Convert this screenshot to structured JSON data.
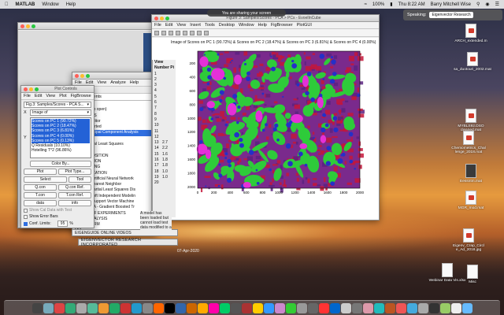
{
  "menubar": {
    "apple": "",
    "app": "MATLAB",
    "items": [
      "Window",
      "Help"
    ],
    "battery": "100%",
    "clock": "Thu 8:22 AM",
    "user": "Barry Mitchell Wise"
  },
  "speaking": {
    "label": "Speaking:",
    "value": "Eigenvector Research"
  },
  "sharing": {
    "text": "You are sharing your screen"
  },
  "figure": {
    "title": "Figure 3: Samples/Scores - PCA > PCs - EvoelInCube",
    "menu": [
      "File",
      "Edit",
      "View",
      "Insert",
      "Tools",
      "Desktop",
      "Window",
      "Help",
      "FigBrowser",
      "PlotGUI"
    ],
    "plot_title": "Image of Scores on PC 1 (90.72%) & Scores on PC 2 (18.47%) & Scores on PC 3 (6.81%) & Scores on PC 4 (0.00%) & Scores on PC 5 (0.13%)",
    "y_ticks": [
      "200",
      "400",
      "600",
      "800",
      "1000",
      "1200",
      "1400",
      "1600",
      "1800",
      "2000"
    ],
    "x_ticks": [
      "0",
      "200",
      "400",
      "600",
      "800",
      "1000",
      "1200",
      "1400",
      "1600",
      "1800",
      "2000"
    ],
    "colors": {
      "green": "#2ecb3a",
      "red": "#c4163a",
      "blue": "#2430c8",
      "magenta": "#e530d8",
      "bg": "#7a2a8c"
    }
  },
  "analysis": {
    "menu": [
      "File",
      "Edit",
      "View",
      "Analyze",
      "Help"
    ],
    "path": ".../Documents",
    "items": [
      "Tools",
      "(File click to open)",
      "FAVORITES",
      "DataSet Editor",
      "Getting Started",
      "PCA - Principal Component Analysis",
      "PLS",
      "PLS - Partial Least Squares",
      "Trend Tool",
      "DECOMPOSITION",
      "REGRESSION",
      "CLUSTERING",
      "CLASSIFICATION",
      "ANNDA - Artificial Neural Network",
      "KNN - K-Nearest Neighbor",
      "PLSDA - Partial Least Squares Dis",
      "SIMCA - Soft Independent Modelin",
      "SVMDA - Support Vector Machine",
      "XGBoostDA - Gradient Boosted Tr",
      "DESIGN OF EXPERIMENTS",
      "IMAGE ANALYSIS",
      "TRANSFORM",
      "MIA",
      "LINE PROCESSING",
      "EIGENGUIDE ONLINE VIDEOS"
    ],
    "selected_index": 5,
    "side_header": "View",
    "side_sub": "Number Pi",
    "side_numbers": [
      "1",
      "2",
      "3",
      "4",
      "5",
      "6",
      "7",
      "8",
      "9",
      "10",
      "11",
      "12",
      "13",
      "14",
      "15",
      "16",
      "17",
      "18",
      "19",
      "20"
    ],
    "side_values": [
      "2.7",
      "2.2",
      "1.6",
      "1.8",
      "1.8",
      "1.0",
      "1.0"
    ],
    "note": "A model has been loaded but cannot load test data modified to a"
  },
  "plot_controls": {
    "title": "Plot Controls",
    "menu": [
      "File",
      "Edit",
      "View",
      "Plot",
      "FigBrowse"
    ],
    "figure_select": "Fig.3: Samples/Scores - PCA S...",
    "mode_select": "Image of",
    "axis_label": "X",
    "y_label": "Y",
    "list_items": [
      "Scores on PC 1 (90.72%)",
      "Scores on PC 2 (18.47%)",
      "Scores on PC 3 (6.81%)",
      "Scores on PC 4 (0.00%)",
      "Scores on PC 5 (0.13%)",
      "Q Residuals (10.10%)",
      "Hotelling T^2 (96.86%)"
    ],
    "highlighted": 5,
    "color_by": "Color By...",
    "plot_btn": "Plot",
    "plot_type_btn": "Plot Type...",
    "select_btn": "Select",
    "tool_btn": "Tool",
    "btn_grid": [
      "Q.con",
      "Q.con Ref.",
      "T.con",
      "T.con Ref.",
      "data",
      "info"
    ],
    "show_cal": "Show Cal Data with Test",
    "show_error": "Show Error Bars",
    "conf_limits": "Conf. Limits:",
    "conf_value": "95",
    "conf_unit": "%"
  },
  "bottom": {
    "strip1": "EIGENGUIDE ONLINE VIDEOS",
    "strip2": "EIGENVECTOR RESEARCH INCORPORATED",
    "date": "07-Apr-2020"
  },
  "desktop_files": [
    "ARCH_extended.m",
    "sa_duotouri_2002.mat",
    "MYBLS92.DSO cleaned.mat",
    "Chemometrics_Chal lenge_2018.mat",
    "Eessntm.mat",
    "MGR_mod.mat",
    "Eigenv_Crap_Circl e_Ad_2018.jpg",
    "Webinar Data Vis.xlsx",
    "Misc"
  ]
}
